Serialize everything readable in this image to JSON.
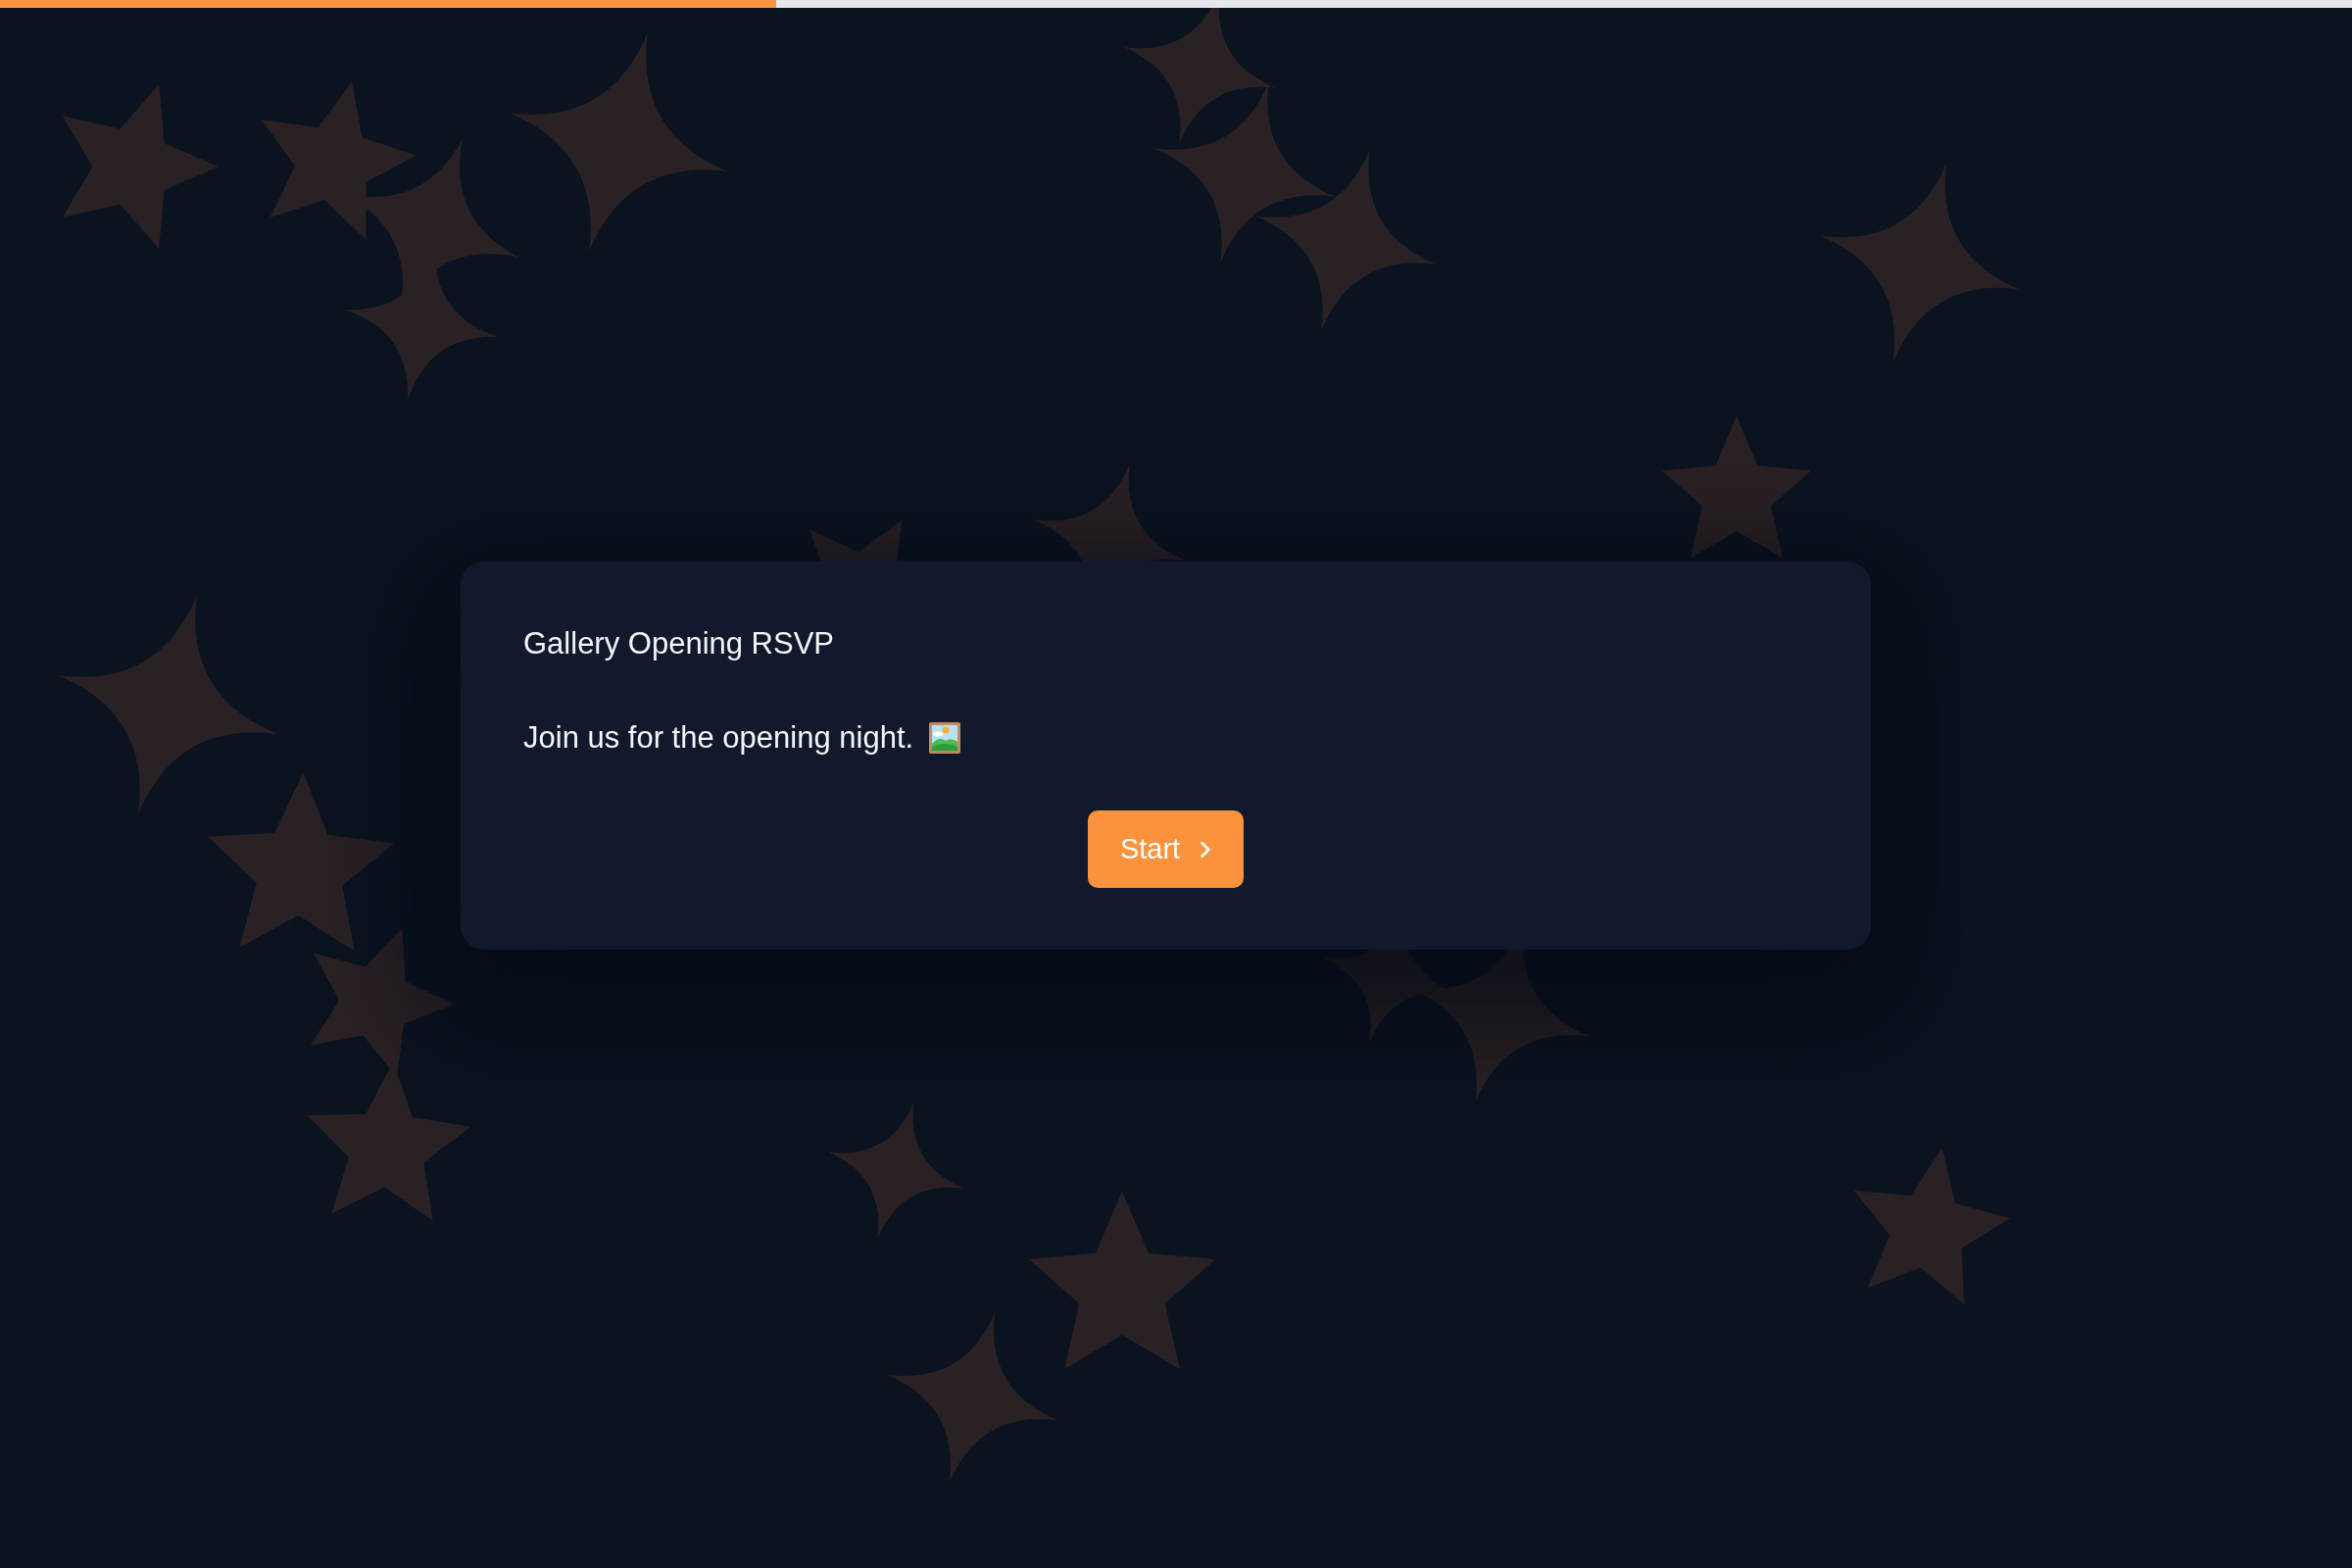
{
  "progress": {
    "level": 0.33
  },
  "card": {
    "title": "Gallery Opening RSVP",
    "message": "Join us for the opening night.",
    "button": {
      "label": "Start"
    }
  }
}
